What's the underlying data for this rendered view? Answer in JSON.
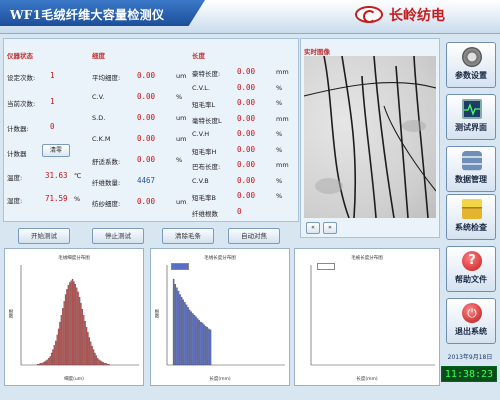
{
  "app": {
    "title": "WF1毛绒纤维大容量检测仪",
    "brand": "长岭纺电"
  },
  "instrument": {
    "heading": "仪器状态",
    "set_count_label": "设定次数:",
    "set_count": "1",
    "current_count_label": "当前次数:",
    "current_count": "1",
    "counter_label": "计数器:",
    "counter": "0",
    "counter2_label": "计数器",
    "clear_label": "清零",
    "temp_label": "温度:",
    "temp": "31.63",
    "temp_unit": "℃",
    "humidity_label": "湿度:",
    "humidity": "71.59",
    "humidity_unit": "%"
  },
  "fineness": {
    "heading": "细度",
    "rows": [
      {
        "label": "平均细度:",
        "value": "0.00",
        "unit": "um"
      },
      {
        "label": "C.V.",
        "value": "0.00",
        "unit": "%"
      },
      {
        "label": "S.D.",
        "value": "0.00",
        "unit": "um"
      },
      {
        "label": "C.K.M",
        "value": "0.00",
        "unit": "um"
      },
      {
        "label": "舒适系数:",
        "value": "0.00",
        "unit": "%"
      },
      {
        "label": "纤维数量:",
        "value": "4467",
        "unit": ""
      },
      {
        "label": "纺纱细度:",
        "value": "0.00",
        "unit": "um"
      }
    ]
  },
  "length": {
    "heading": "长度",
    "rows": [
      {
        "label": "豪特长度:",
        "value": "0.00",
        "unit": "mm"
      },
      {
        "label": "C.V.L.",
        "value": "0.00",
        "unit": "%"
      },
      {
        "label": "短毛率L",
        "value": "0.00",
        "unit": "%"
      },
      {
        "label": "毫特长度L",
        "value": "0.00",
        "unit": "mm"
      },
      {
        "label": "C.V.H",
        "value": "0.00",
        "unit": "%"
      },
      {
        "label": "短毛率H",
        "value": "0.00",
        "unit": "%"
      },
      {
        "label": "巴布长度:",
        "value": "0.00",
        "unit": "mm"
      },
      {
        "label": "C.V.B",
        "value": "0.00",
        "unit": "%"
      },
      {
        "label": "短毛率B",
        "value": "0.00",
        "unit": "%"
      },
      {
        "label": "纤维根数",
        "value": "0",
        "unit": ""
      }
    ]
  },
  "image": {
    "heading": "实时图像",
    "prev": "«",
    "next": "»"
  },
  "actions": {
    "start": "开始测试",
    "stop": "停止测试",
    "clear": "清除毛条",
    "auto": "自动对焦"
  },
  "nav": {
    "params": "参数设置",
    "test": "测试界面",
    "data": "数据管理",
    "system": "系统检查",
    "help": "帮助文件",
    "exit": "退出系统"
  },
  "status": {
    "date": "2013年9月18日",
    "time": "11:38:23"
  },
  "colors": {
    "accent": "#1c4f9a",
    "value_red": "#cc1111",
    "bar_red": "#c85050",
    "bar_blue": "#5a6ec8",
    "clock_bg": "#0b4d1a",
    "clock_fg": "#38ff5a"
  },
  "chart_data": [
    {
      "type": "bar",
      "title": "毛绒细度分布图",
      "xlabel": "细度(um)",
      "ylabel": "根数",
      "legend": "",
      "values": [
        1,
        1,
        2,
        2,
        3,
        4,
        5,
        6,
        8,
        10,
        14,
        18,
        23,
        28,
        35,
        42,
        50,
        58,
        66,
        74,
        82,
        88,
        93,
        96,
        98,
        100,
        97,
        94,
        90,
        85,
        79,
        72,
        65,
        58,
        51,
        44,
        38,
        32,
        27,
        22,
        18,
        14,
        11,
        8,
        6,
        5,
        4,
        3,
        2,
        2,
        1,
        1
      ]
    },
    {
      "type": "bar",
      "title": "毛绒长度分布图",
      "xlabel": "长度(mm)",
      "ylabel": "根数",
      "legend": "",
      "values": [
        100,
        94,
        90,
        86,
        82,
        79,
        76,
        73,
        70,
        67,
        64,
        62,
        60,
        58,
        56,
        54,
        52,
        50,
        49,
        47,
        45,
        44,
        42,
        41
      ]
    },
    {
      "type": "bar",
      "title": "毛被长度分布图",
      "xlabel": "长度(mm)",
      "ylabel": "",
      "legend": "",
      "values": []
    }
  ]
}
